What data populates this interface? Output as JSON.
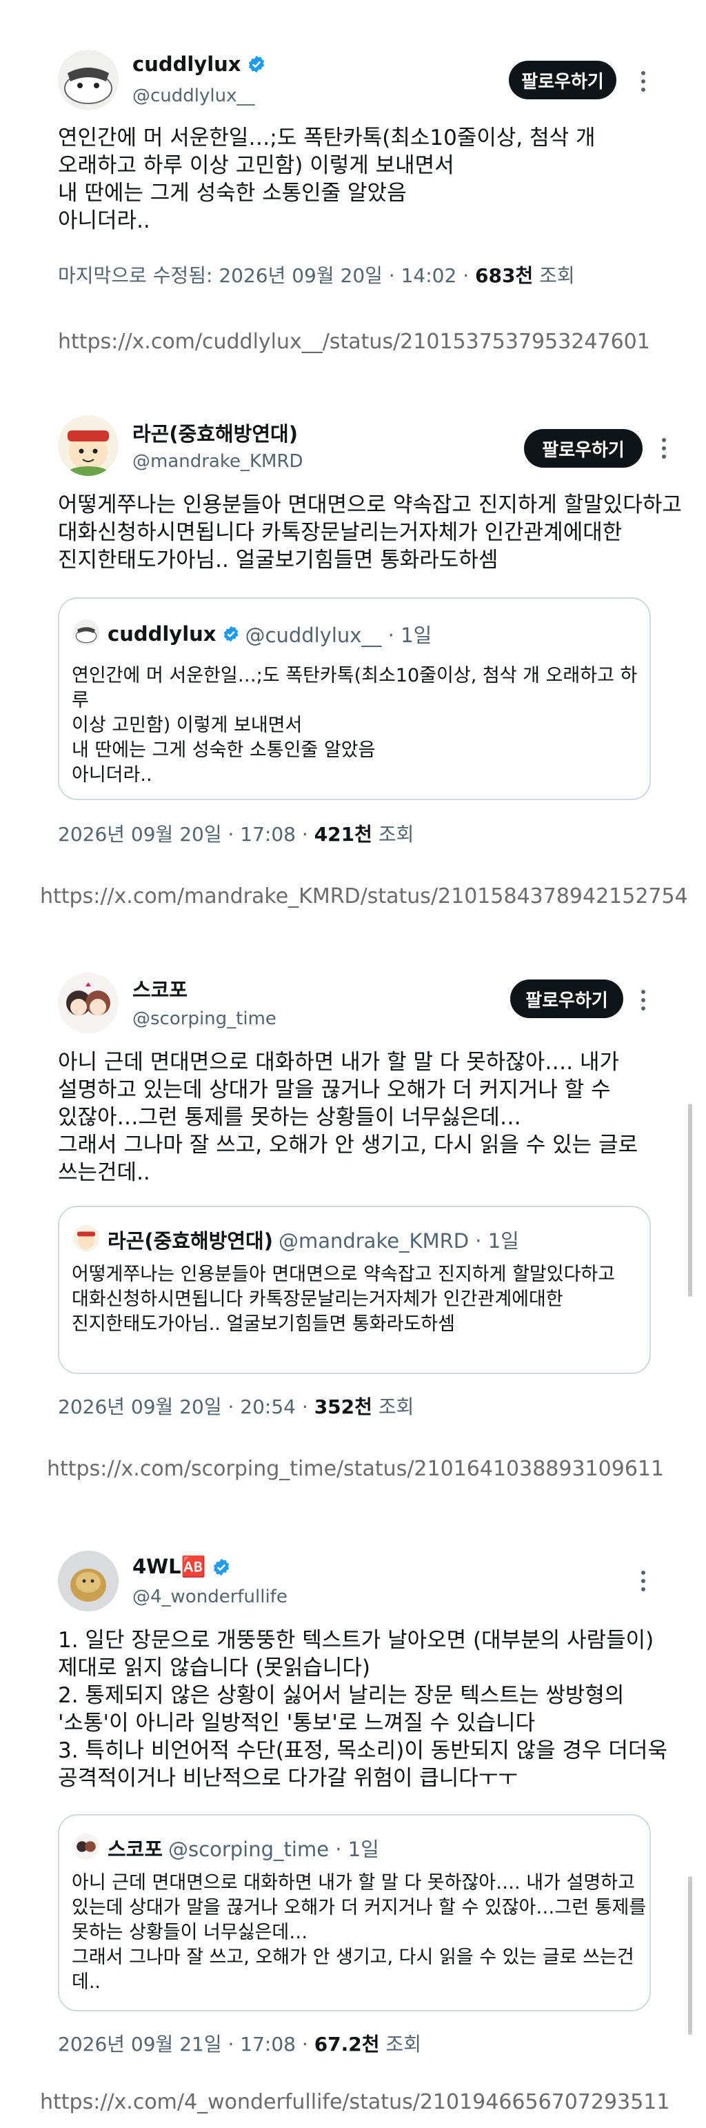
{
  "posts": [
    {
      "name": "cuddlylux",
      "handle": "@cuddlylux__",
      "follow": "팔로우하기",
      "text": "연인간에 머 서운한일…;도 폭탄카톡(최소10줄이상, 첨삭 개\n오래하고 하루 이상 고민함) 이렇게 보내면서\n내 딴에는 그게 성숙한 소통인줄 알았음\n아니더라..",
      "meta_prefix": "마지막으로 수정됨: 2026년 09월 20일 · 14:02 · ",
      "views": "683천",
      "views_label": " 조회",
      "url": "https://x.com/cuddlylux__/status/2101537537953247601"
    },
    {
      "name": "라곤(중효해방연대)",
      "handle": "@mandrake_KMRD",
      "follow": "팔로우하기",
      "text": "어떻게쭈나는 인용분들아 면대면으로 약속잡고 진지하게 할말있다하고\n대화신청하시면됩니다 카톡장문날리는거자체가 인간관계에대한\n진지한태도가아님.. 얼굴보기힘들면 통화라도하셈",
      "quote": {
        "name": "cuddlylux",
        "handle": "@cuddlylux__ · 1일",
        "text": "연인간에 머 서운한일…;도 폭탄카톡(최소10줄이상, 첨삭 개 오래하고 하루\n이상 고민함) 이렇게 보내면서\n내 딴에는 그게 성숙한 소통인줄 알았음\n아니더라.."
      },
      "meta_prefix": "2026년 09월 20일 · 17:08 · ",
      "views": "421천",
      "views_label": " 조회",
      "url": "https://x.com/mandrake_KMRD/status/2101584378942152754"
    },
    {
      "name": "스코포",
      "handle": "@scorping_time",
      "follow": "팔로우하기",
      "text": "아니 근데 면대면으로 대화하면 내가 할 말 다 못하잖아…. 내가\n설명하고 있는데 상대가 말을 끊거나 오해가 더 커지거나 할 수\n있잖아…그런 통제를 못하는 상황들이 너무싫은데…\n그래서 그나마 잘 쓰고, 오해가 안 생기고, 다시 읽을 수 있는 글로\n쓰는건데..",
      "quote": {
        "name": "라곤(중효해방연대)",
        "handle": "@mandrake_KMRD · 1일",
        "text": "어떻게쭈나는 인용분들아 면대면으로 약속잡고 진지하게 할말있다하고\n대화신청하시면됩니다 카톡장문날리는거자체가 인간관계에대한\n진지한태도가아님.. 얼굴보기힘들면 통화라도하셈"
      },
      "meta_prefix": "2026년 09월 20일 · 20:54 · ",
      "views": "352천",
      "views_label": " 조회",
      "url": "https://x.com/scorping_time/status/2101641038893109611"
    },
    {
      "name": "4WL🆎",
      "handle": "@4_wonderfullife",
      "text": "1. 일단 장문으로 개뚱뚱한 텍스트가 날아오면 (대부분의 사람들이)\n제대로 읽지 않습니다 (못읽습니다)\n2. 통제되지 않은 상황이 싫어서 날리는 장문 텍스트는 쌍방형의\n'소통'이 아니라 일방적인 '통보'로 느껴질 수 있습니다\n3. 특히나 비언어적 수단(표정, 목소리)이 동반되지 않을 경우 더더욱\n공격적이거나 비난적으로 다가갈 위험이 큽니다ㅜㅜ",
      "quote": {
        "name": "스코포",
        "handle": "@scorping_time · 1일",
        "text": "아니 근데 면대면으로 대화하면 내가 할 말 다 못하잖아…. 내가 설명하고\n있는데 상대가 말을 끊거나 오해가 더 커지거나 할 수 있잖아…그런 통제를\n못하는 상황들이 너무싫은데…\n그래서 그나마 잘 쓰고, 오해가 안 생기고, 다시 읽을 수 있는 글로 쓰는건데.."
      },
      "meta_prefix": "2026년 09월 21일 · 17:08 · ",
      "views": "67.2천",
      "views_label": " 조회",
      "url": "https://x.com/4_wonderfullife/status/2101946656707293511"
    }
  ],
  "colors": {
    "text": "#0f1419",
    "secondary": "#536471",
    "verified": "#1d9bf0",
    "button": "#0f1419",
    "border": "#cfd9de"
  }
}
